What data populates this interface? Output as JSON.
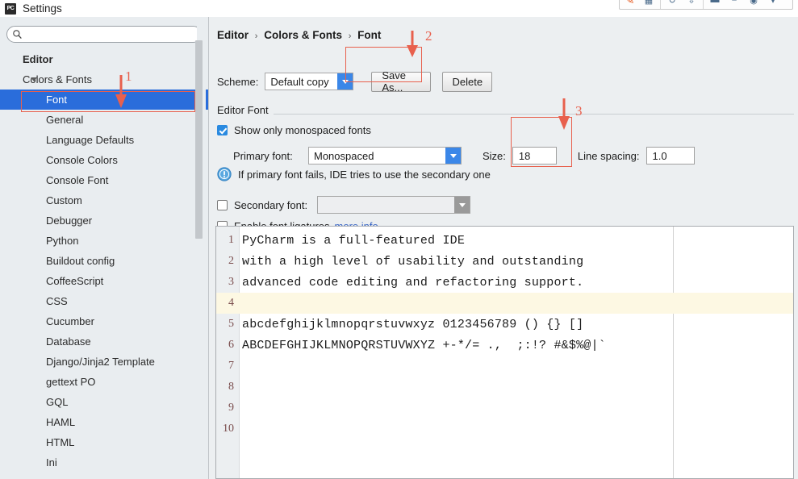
{
  "window": {
    "title": "Settings",
    "app_icon": "pycharm-icon",
    "app_icon_text": "PC"
  },
  "float_toolbar": {
    "items": [
      "pen-icon",
      "pc-icon",
      "refresh-icon",
      "download-icon",
      "minus-icon",
      "abc-icon",
      "globe-icon",
      "chevron-down-icon"
    ]
  },
  "sidebar": {
    "search": {
      "value": "",
      "placeholder": "",
      "icon": "search-icon"
    },
    "items": [
      {
        "label": "Editor",
        "level": "root",
        "selected": false,
        "arrow": ""
      },
      {
        "label": "Colors & Fonts",
        "level": "lvl1",
        "selected": false,
        "arrow": "open"
      },
      {
        "label": "Font",
        "level": "lvl2",
        "selected": true,
        "arrow": ""
      },
      {
        "label": "General",
        "level": "lvl2",
        "selected": false,
        "arrow": ""
      },
      {
        "label": "Language Defaults",
        "level": "lvl2",
        "selected": false,
        "arrow": ""
      },
      {
        "label": "Console Colors",
        "level": "lvl2",
        "selected": false,
        "arrow": ""
      },
      {
        "label": "Console Font",
        "level": "lvl2",
        "selected": false,
        "arrow": ""
      },
      {
        "label": "Custom",
        "level": "lvl2",
        "selected": false,
        "arrow": ""
      },
      {
        "label": "Debugger",
        "level": "lvl2",
        "selected": false,
        "arrow": ""
      },
      {
        "label": "Python",
        "level": "lvl2",
        "selected": false,
        "arrow": ""
      },
      {
        "label": "Buildout config",
        "level": "lvl2",
        "selected": false,
        "arrow": ""
      },
      {
        "label": "CoffeeScript",
        "level": "lvl2",
        "selected": false,
        "arrow": ""
      },
      {
        "label": "CSS",
        "level": "lvl2",
        "selected": false,
        "arrow": ""
      },
      {
        "label": "Cucumber",
        "level": "lvl2",
        "selected": false,
        "arrow": ""
      },
      {
        "label": "Database",
        "level": "lvl2",
        "selected": false,
        "arrow": ""
      },
      {
        "label": "Django/Jinja2 Template",
        "level": "lvl2",
        "selected": false,
        "arrow": ""
      },
      {
        "label": "gettext PO",
        "level": "lvl2",
        "selected": false,
        "arrow": ""
      },
      {
        "label": "GQL",
        "level": "lvl2",
        "selected": false,
        "arrow": ""
      },
      {
        "label": "HAML",
        "level": "lvl2",
        "selected": false,
        "arrow": ""
      },
      {
        "label": "HTML",
        "level": "lvl2",
        "selected": false,
        "arrow": ""
      },
      {
        "label": "Ini",
        "level": "lvl2",
        "selected": false,
        "arrow": ""
      }
    ]
  },
  "main": {
    "breadcrumb": {
      "part1": "Editor",
      "part2": "Colors & Fonts",
      "part3": "Font",
      "separator": "›"
    },
    "scheme": {
      "label": "Scheme:",
      "value": "Default copy",
      "save_as_label": "Save As...",
      "delete_label": "Delete"
    },
    "group_title": "Editor Font",
    "show_monospaced": {
      "label": "Show only monospaced fonts",
      "checked": true
    },
    "primary_font": {
      "label": "Primary font:",
      "value": "Monospaced"
    },
    "size": {
      "label": "Size:",
      "value": "18"
    },
    "line_spacing": {
      "label": "Line spacing:",
      "value": "1.0"
    },
    "info_note": "If primary font fails, IDE tries to use the secondary one",
    "secondary_font": {
      "label": "Secondary font:",
      "value": "",
      "checked": false
    },
    "ligatures": {
      "label": "Enable font ligatures",
      "link": "more info",
      "checked": false
    }
  },
  "preview": {
    "lines": [
      {
        "n": "1",
        "text": "PyCharm is a full-featured IDE",
        "highlight": false
      },
      {
        "n": "2",
        "text": "with a high level of usability and outstanding",
        "highlight": false
      },
      {
        "n": "3",
        "text": "advanced code editing and refactoring support.",
        "highlight": false
      },
      {
        "n": "4",
        "text": "",
        "highlight": true
      },
      {
        "n": "5",
        "text": "abcdefghijklmnopqrstuvwxyz 0123456789 () {} []",
        "highlight": false
      },
      {
        "n": "6",
        "text": "ABCDEFGHIJKLMNOPQRSTUVWXYZ +-*/= .,  ;:!? #&$%@|`",
        "highlight": false
      },
      {
        "n": "7",
        "text": "",
        "highlight": false
      },
      {
        "n": "8",
        "text": "",
        "highlight": false
      },
      {
        "n": "9",
        "text": "",
        "highlight": false
      },
      {
        "n": "10",
        "text": "",
        "highlight": false
      }
    ]
  },
  "annotations": {
    "accent_color": "#e8604d",
    "markers": [
      {
        "number": "1",
        "target": "sidebar-item-font"
      },
      {
        "number": "2",
        "target": "save-as-button"
      },
      {
        "number": "3",
        "target": "size-field"
      }
    ]
  }
}
